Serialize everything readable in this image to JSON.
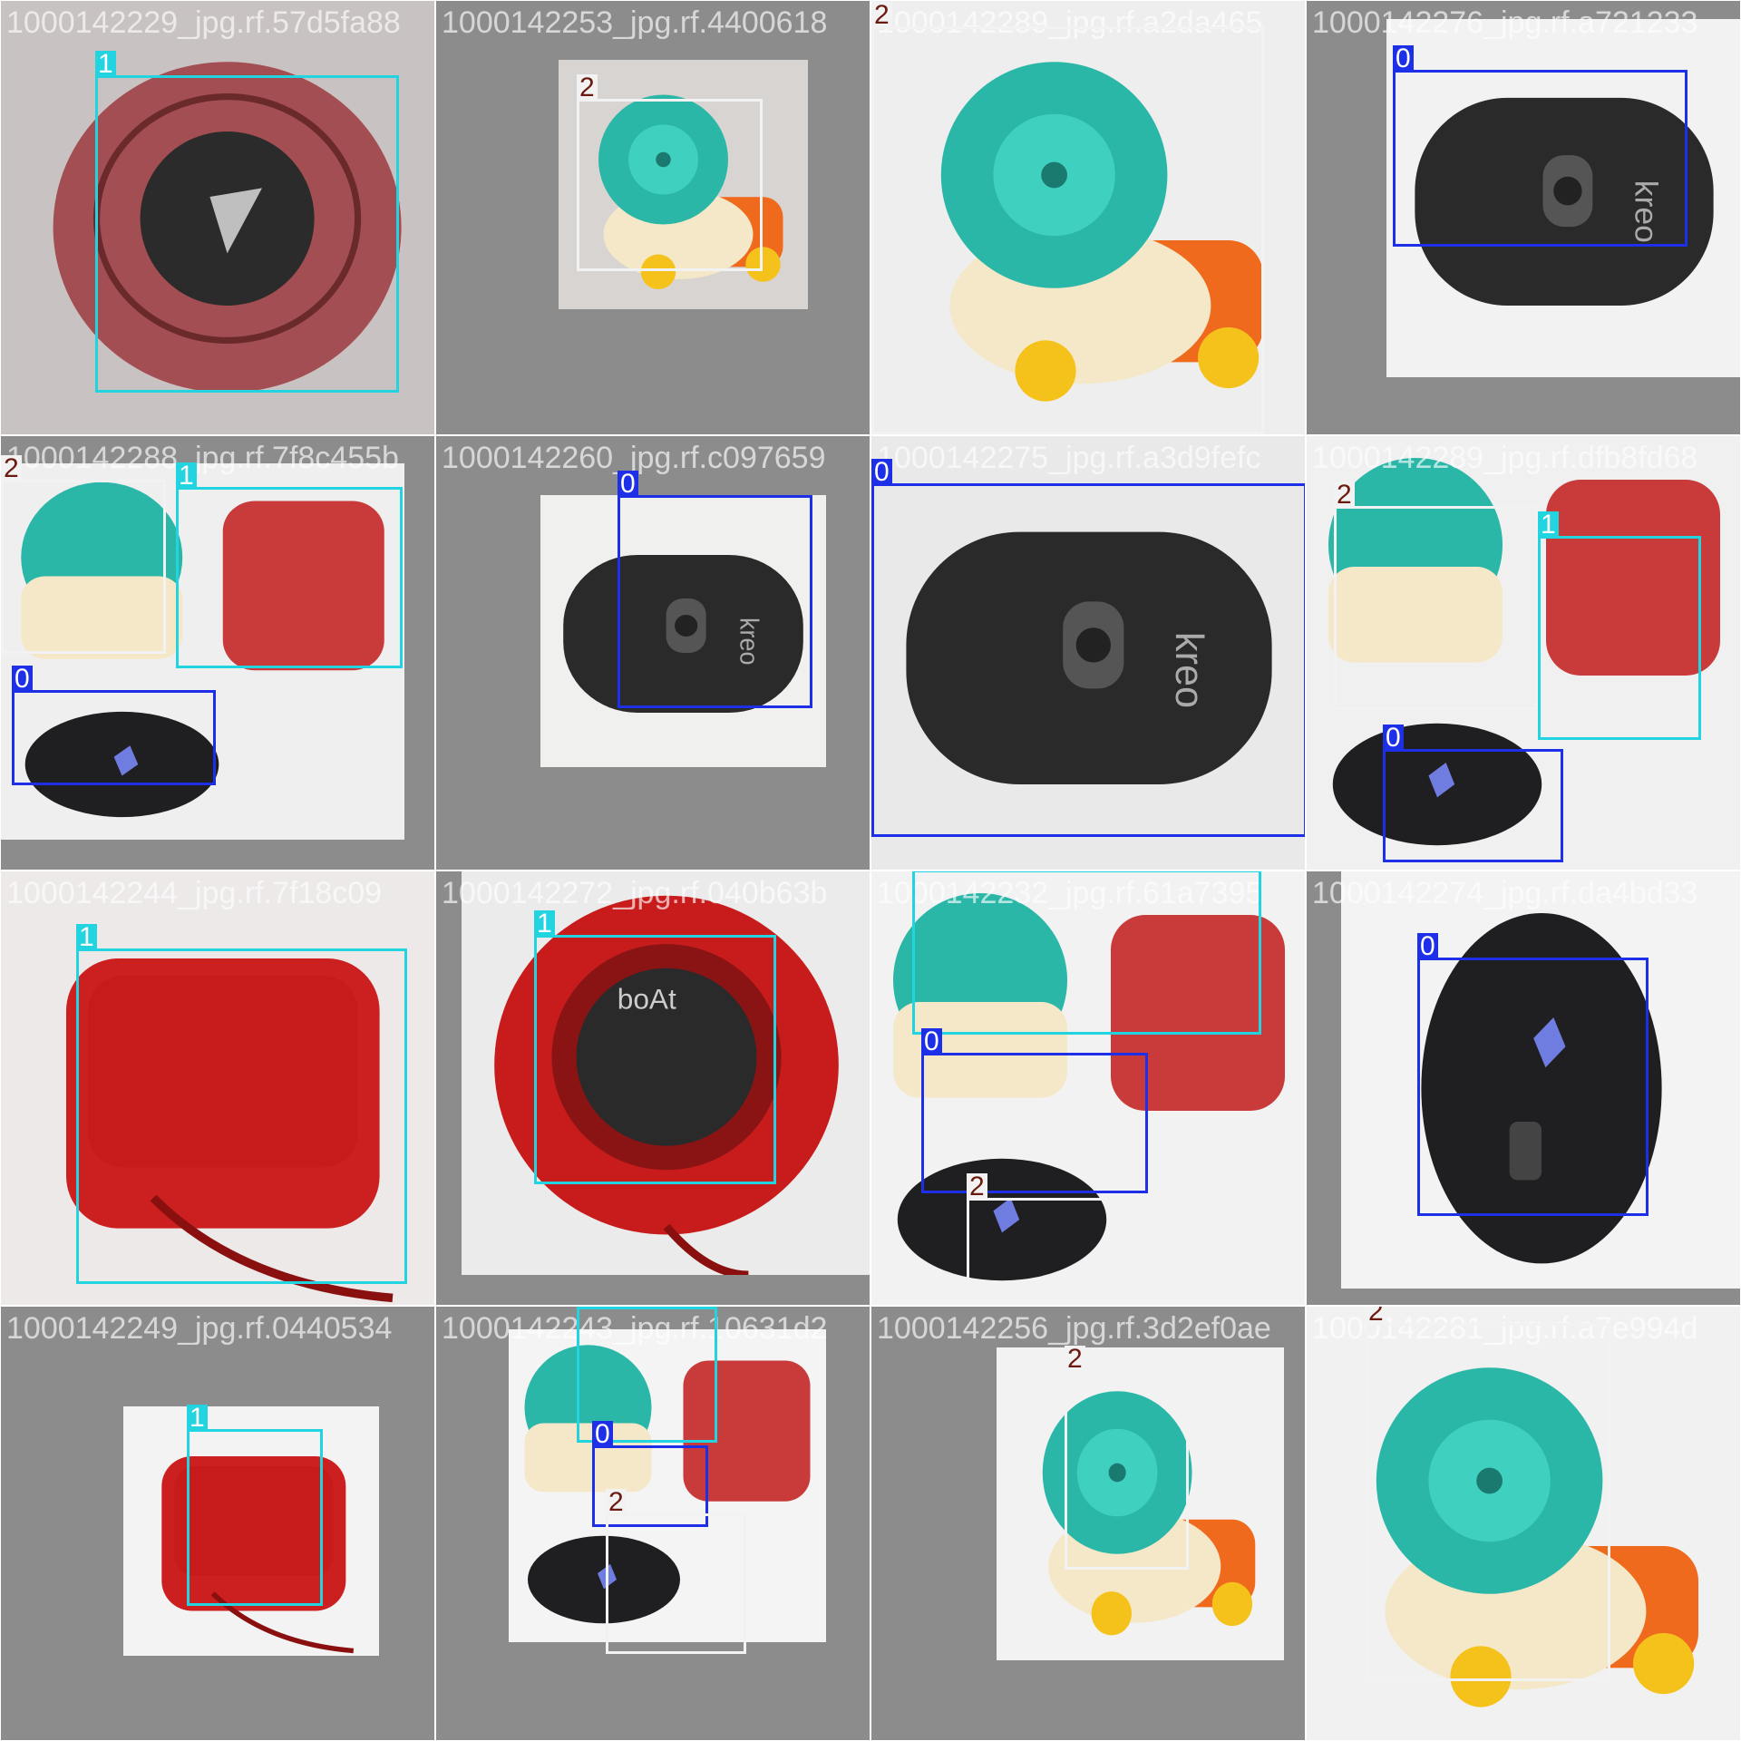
{
  "colors": {
    "class_0": "#1e2fe8",
    "class_1": "#22d3e0",
    "class_2": "#f2f2f2",
    "label_2_text": "#6b1a10",
    "background": "#8c8c8c"
  },
  "tiles": [
    {
      "filename": "1000142229_jpg.rf.57d5fa88",
      "subject": "speaker-round"
    },
    {
      "filename": "1000142253_jpg.rf.4400618",
      "subject": "snail-toy"
    },
    {
      "filename": "1000142289_jpg.rf.a2da465",
      "subject": "snail-toy"
    },
    {
      "filename": "1000142276_jpg.rf.a721233",
      "subject": "mouse-bottom"
    },
    {
      "filename": "1000142288_jpg.rf.7f8c455b",
      "subject": "mixed"
    },
    {
      "filename": "1000142260_jpg.rf.c097659",
      "subject": "mouse-bottom"
    },
    {
      "filename": "1000142275_jpg.rf.a3d9fefc",
      "subject": "mouse-bottom"
    },
    {
      "filename": "1000142289_jpg.rf.dfb8fd68",
      "subject": "mixed"
    },
    {
      "filename": "1000142244_jpg.rf.7f18c09",
      "subject": "speaker-red"
    },
    {
      "filename": "1000142272_jpg.rf.040b63b",
      "subject": "speaker-round-red"
    },
    {
      "filename": "1000142232_jpg.rf.61a7395",
      "subject": "mixed"
    },
    {
      "filename": "1000142274_jpg.rf.da4bd33",
      "subject": "mouse-top"
    },
    {
      "filename": "1000142249_jpg.rf.0440534",
      "subject": "speaker-red"
    },
    {
      "filename": "1000142243_jpg.rf.10631d2",
      "subject": "mixed"
    },
    {
      "filename": "1000142256_jpg.rf.3d2ef0ae",
      "subject": "snail-toy"
    },
    {
      "filename": "1000142281_jpg.rf.a7e994d",
      "subject": "snail-toy"
    }
  ],
  "boxes": [
    {
      "tile": 0,
      "cls": 1,
      "label": "1"
    },
    {
      "tile": 1,
      "cls": 2,
      "label": "2"
    },
    {
      "tile": 2,
      "cls": 2,
      "label": "2"
    },
    {
      "tile": 3,
      "cls": 0,
      "label": "0"
    },
    {
      "tile": 4,
      "cls": 2,
      "label": "2"
    },
    {
      "tile": 4,
      "cls": 1,
      "label": "1"
    },
    {
      "tile": 4,
      "cls": 0,
      "label": "0"
    },
    {
      "tile": 5,
      "cls": 0,
      "label": "0"
    },
    {
      "tile": 6,
      "cls": 0,
      "label": "0"
    },
    {
      "tile": 7,
      "cls": 2,
      "label": "2"
    },
    {
      "tile": 7,
      "cls": 1,
      "label": "1"
    },
    {
      "tile": 7,
      "cls": 0,
      "label": "0"
    },
    {
      "tile": 8,
      "cls": 1,
      "label": "1"
    },
    {
      "tile": 9,
      "cls": 1,
      "label": "1"
    },
    {
      "tile": 10,
      "cls": 1,
      "label": "1"
    },
    {
      "tile": 10,
      "cls": 0,
      "label": "0"
    },
    {
      "tile": 10,
      "cls": 2,
      "label": "2"
    },
    {
      "tile": 11,
      "cls": 0,
      "label": "0"
    },
    {
      "tile": 12,
      "cls": 1,
      "label": "1"
    },
    {
      "tile": 13,
      "cls": 1,
      "label": "1"
    },
    {
      "tile": 13,
      "cls": 0,
      "label": "0"
    },
    {
      "tile": 13,
      "cls": 2,
      "label": "2"
    },
    {
      "tile": 14,
      "cls": 2,
      "label": "2"
    },
    {
      "tile": 15,
      "cls": 2,
      "label": "2"
    }
  ]
}
